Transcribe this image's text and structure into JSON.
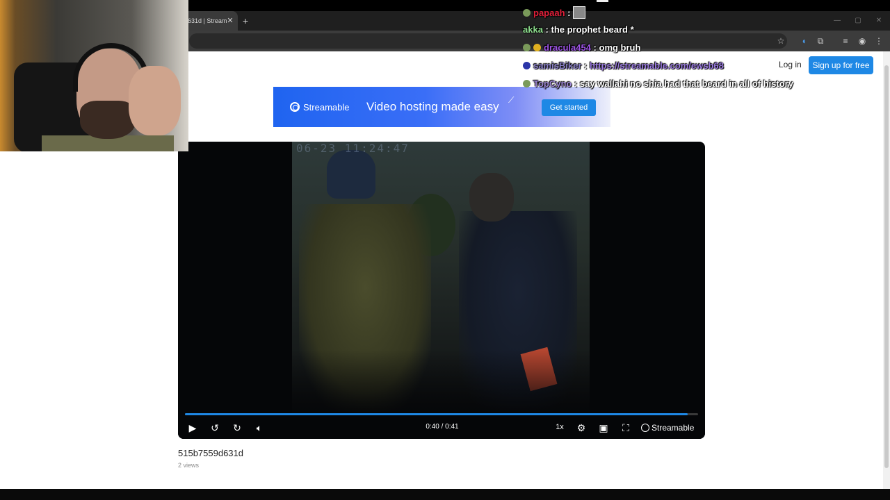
{
  "browser": {
    "tab_title": "631d | Stream",
    "tab_close": "✕",
    "new_tab": "+",
    "window_controls": {
      "minimize": "—",
      "maximize": "▢",
      "close": "✕"
    }
  },
  "site": {
    "login_label": "Log in",
    "signup_label": "Sign up for free"
  },
  "banner": {
    "brand": "Streamable",
    "tagline": "Video hosting made easy",
    "cta_label": "Get started"
  },
  "player": {
    "overlay_timestamp": "06-23 11:24:47",
    "current_time": "0:40 / 0:41",
    "progress_fraction": 0.98,
    "speed_label": "1x",
    "brand": "Streamable",
    "icons": [
      "play-icon",
      "rewind-10-icon",
      "forward-10-icon",
      "volume-icon",
      "settings-gear-icon",
      "picture-in-picture-icon",
      "fullscreen-icon"
    ]
  },
  "video": {
    "title": "515b7559d631d",
    "views": "2 views"
  },
  "chat": [
    {
      "user": "papaah",
      "sep": " : ",
      "message": "",
      "user_color": "#e0203a",
      "msg_color": "#ffffff",
      "has_emote": true
    },
    {
      "user": "akka",
      "sep": " : ",
      "message": "the prophet beard *",
      "user_color": "#8fe08f",
      "msg_color": "#ffffff",
      "has_emote": false
    },
    {
      "user": "dracula454",
      "sep": " : ",
      "message": "omg bruh",
      "user_color": "#a055e8",
      "msg_color": "#ffffff",
      "has_emote": false
    },
    {
      "user": "samisBiker",
      "sep": " : ",
      "message": "https://streamable.com/ewsb68",
      "user_color": "#8a80c8",
      "msg_color": "#9a7ae0",
      "has_emote": false
    },
    {
      "user": "TopCyno",
      "sep": " : ",
      "message": "say wallahi no shia had that beard in all of history",
      "user_color": "#a08ad8",
      "msg_color": "#ffffff",
      "has_emote": false
    }
  ],
  "colors": {
    "accent": "#1e88e5",
    "progress": "#1e88e5"
  }
}
